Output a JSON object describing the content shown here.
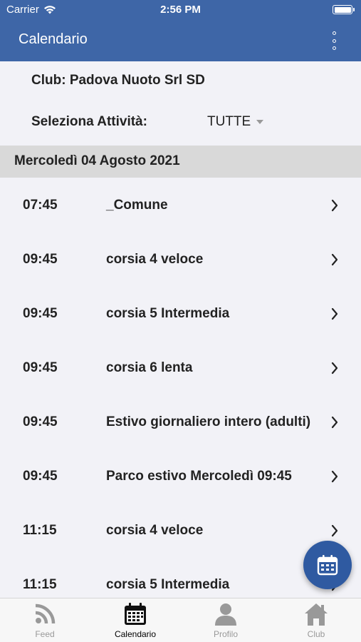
{
  "status_bar": {
    "carrier": "Carrier",
    "time": "2:56 PM"
  },
  "navbar": {
    "title": "Calendario",
    "menu_icon": "more-vertical-icon"
  },
  "club": {
    "label": "Club: Padova Nuoto Srl SD"
  },
  "activity": {
    "label": "Seleziona Attività:",
    "selected": "TUTTE"
  },
  "date_header": "Mercoledì 04 Agosto 2021",
  "events": [
    {
      "time": "07:45",
      "name": "_Comune"
    },
    {
      "time": "09:45",
      "name": "corsia 4 veloce"
    },
    {
      "time": "09:45",
      "name": "corsia 5 Intermedia"
    },
    {
      "time": "09:45",
      "name": "corsia 6 lenta"
    },
    {
      "time": "09:45",
      "name": "Estivo giornaliero intero (adulti)"
    },
    {
      "time": "09:45",
      "name": "Parco estivo Mercoledì 09:45"
    },
    {
      "time": "11:15",
      "name": "corsia 4 veloce"
    },
    {
      "time": "11:15",
      "name": "corsia 5 Intermedia"
    }
  ],
  "fab": {
    "icon": "calendar-icon"
  },
  "tabs": [
    {
      "label": "Feed",
      "icon": "rss-icon"
    },
    {
      "label": "Calendario",
      "icon": "calendar-icon",
      "active": true
    },
    {
      "label": "Profilo",
      "icon": "user-icon"
    },
    {
      "label": "Club",
      "icon": "home-icon"
    }
  ],
  "colors": {
    "primary": "#3e66a7",
    "fab": "#2f5aa1",
    "background": "#f2f2f7",
    "date_header": "#d9d9d9"
  }
}
